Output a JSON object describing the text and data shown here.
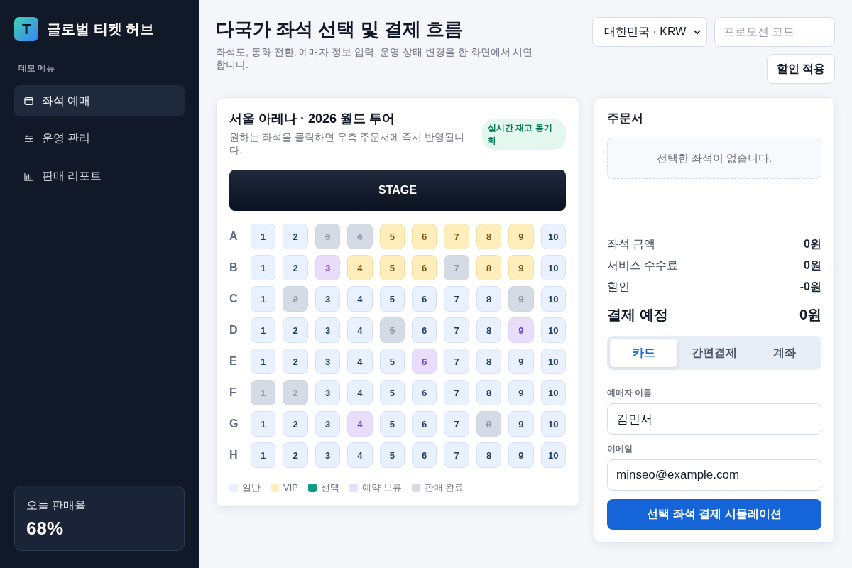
{
  "sidebar": {
    "logo_letter": "T",
    "app_name": "글로벌 티켓 허브",
    "section_label": "데모 메뉴",
    "items": [
      {
        "label": "좌석 예매",
        "selected": true
      },
      {
        "label": "운영 관리",
        "selected": false
      },
      {
        "label": "판매 리포트",
        "selected": false
      }
    ],
    "stat_card": {
      "label": "오늘 판매율",
      "value": "68%"
    }
  },
  "header": {
    "title": "다국가 좌석 선택 및 결제 흐름",
    "subtitle": "좌석도, 통화 전환, 예매자 정보 입력, 운영 상태 변경을 한 화면에서 시연합니다.",
    "region_select": {
      "value": "대한민국 · KRW"
    },
    "promo_code": {
      "placeholder": "프로모션 코드"
    },
    "apply_button": "할인 적용"
  },
  "seat_map": {
    "title": "서울 아레나 · 2026 월드 투어",
    "subtitle": "원하는 좌석을 클릭하면 우측 주문서에 즉시 반영됩니다.",
    "badge": "실시간 재고 동기화",
    "stage": "STAGE",
    "rows": [
      {
        "label": "A",
        "seats": [
          {
            "label": "1",
            "kind": "general"
          },
          {
            "label": "2",
            "kind": "general"
          },
          {
            "label": "3",
            "kind": "sold"
          },
          {
            "label": "4",
            "kind": "sold"
          },
          {
            "label": "5",
            "kind": "vip"
          },
          {
            "label": "6",
            "kind": "vip"
          },
          {
            "label": "7",
            "kind": "vip"
          },
          {
            "label": "8",
            "kind": "vip"
          },
          {
            "label": "9",
            "kind": "vip"
          },
          {
            "label": "10",
            "kind": "general"
          }
        ]
      },
      {
        "label": "B",
        "seats": [
          {
            "label": "1",
            "kind": "general"
          },
          {
            "label": "2",
            "kind": "general"
          },
          {
            "label": "3",
            "kind": "held"
          },
          {
            "label": "4",
            "kind": "vip"
          },
          {
            "label": "5",
            "kind": "vip"
          },
          {
            "label": "6",
            "kind": "vip"
          },
          {
            "label": "7",
            "kind": "sold"
          },
          {
            "label": "8",
            "kind": "vip"
          },
          {
            "label": "9",
            "kind": "vip"
          },
          {
            "label": "10",
            "kind": "general"
          }
        ]
      },
      {
        "label": "C",
        "seats": [
          {
            "label": "1",
            "kind": "general"
          },
          {
            "label": "2",
            "kind": "sold"
          },
          {
            "label": "3",
            "kind": "general"
          },
          {
            "label": "4",
            "kind": "general"
          },
          {
            "label": "5",
            "kind": "general"
          },
          {
            "label": "6",
            "kind": "general"
          },
          {
            "label": "7",
            "kind": "general"
          },
          {
            "label": "8",
            "kind": "general"
          },
          {
            "label": "9",
            "kind": "sold"
          },
          {
            "label": "10",
            "kind": "general"
          }
        ]
      },
      {
        "label": "D",
        "seats": [
          {
            "label": "1",
            "kind": "general"
          },
          {
            "label": "2",
            "kind": "general"
          },
          {
            "label": "3",
            "kind": "general"
          },
          {
            "label": "4",
            "kind": "general"
          },
          {
            "label": "5",
            "kind": "sold"
          },
          {
            "label": "6",
            "kind": "general"
          },
          {
            "label": "7",
            "kind": "general"
          },
          {
            "label": "8",
            "kind": "general"
          },
          {
            "label": "9",
            "kind": "held"
          },
          {
            "label": "10",
            "kind": "general"
          }
        ]
      },
      {
        "label": "E",
        "seats": [
          {
            "label": "1",
            "kind": "general"
          },
          {
            "label": "2",
            "kind": "general"
          },
          {
            "label": "3",
            "kind": "general"
          },
          {
            "label": "4",
            "kind": "general"
          },
          {
            "label": "5",
            "kind": "general"
          },
          {
            "label": "6",
            "kind": "held"
          },
          {
            "label": "7",
            "kind": "general"
          },
          {
            "label": "8",
            "kind": "general"
          },
          {
            "label": "9",
            "kind": "general"
          },
          {
            "label": "10",
            "kind": "general"
          }
        ]
      },
      {
        "label": "F",
        "seats": [
          {
            "label": "1",
            "kind": "sold"
          },
          {
            "label": "2",
            "kind": "sold"
          },
          {
            "label": "3",
            "kind": "general"
          },
          {
            "label": "4",
            "kind": "general"
          },
          {
            "label": "5",
            "kind": "general"
          },
          {
            "label": "6",
            "kind": "general"
          },
          {
            "label": "7",
            "kind": "general"
          },
          {
            "label": "8",
            "kind": "general"
          },
          {
            "label": "9",
            "kind": "general"
          },
          {
            "label": "10",
            "kind": "general"
          }
        ]
      },
      {
        "label": "G",
        "seats": [
          {
            "label": "1",
            "kind": "general"
          },
          {
            "label": "2",
            "kind": "general"
          },
          {
            "label": "3",
            "kind": "general"
          },
          {
            "label": "4",
            "kind": "held"
          },
          {
            "label": "5",
            "kind": "general"
          },
          {
            "label": "6",
            "kind": "general"
          },
          {
            "label": "7",
            "kind": "general"
          },
          {
            "label": "8",
            "kind": "sold"
          },
          {
            "label": "9",
            "kind": "general"
          },
          {
            "label": "10",
            "kind": "general"
          }
        ]
      },
      {
        "label": "H",
        "seats": [
          {
            "label": "1",
            "kind": "general"
          },
          {
            "label": "2",
            "kind": "general"
          },
          {
            "label": "3",
            "kind": "general"
          },
          {
            "label": "4",
            "kind": "general"
          },
          {
            "label": "5",
            "kind": "general"
          },
          {
            "label": "6",
            "kind": "general"
          },
          {
            "label": "7",
            "kind": "general"
          },
          {
            "label": "8",
            "kind": "general"
          },
          {
            "label": "9",
            "kind": "general"
          },
          {
            "label": "10",
            "kind": "general"
          }
        ]
      }
    ],
    "legend": [
      {
        "label": "일반",
        "color": "#e8f1fd"
      },
      {
        "label": "VIP",
        "color": "#fdeebc"
      },
      {
        "label": "선택",
        "color": "#0f9d82"
      },
      {
        "label": "예약 보류",
        "color": "#e9ddfc"
      },
      {
        "label": "판매 완료",
        "color": "#d4dbe5"
      }
    ]
  },
  "order": {
    "title": "주문서",
    "empty_message": "선택한 좌석이 없습니다.",
    "lines": [
      {
        "label": "좌석 금액",
        "amount": "0원"
      },
      {
        "label": "서비스 수수료",
        "amount": "0원"
      },
      {
        "label": "할인",
        "amount": "-0원"
      }
    ],
    "total": {
      "label": "결제 예정",
      "amount": "0원"
    },
    "payment_tabs": [
      {
        "label": "카드",
        "selected": true
      },
      {
        "label": "간편결제",
        "selected": false
      },
      {
        "label": "계좌",
        "selected": false
      }
    ],
    "fields": [
      {
        "label": "예매자 이름",
        "value": "김민서"
      },
      {
        "label": "이메일",
        "value": "minseo@example.com"
      }
    ],
    "submit_button": "선택 좌석 결제 시뮬레이션"
  }
}
